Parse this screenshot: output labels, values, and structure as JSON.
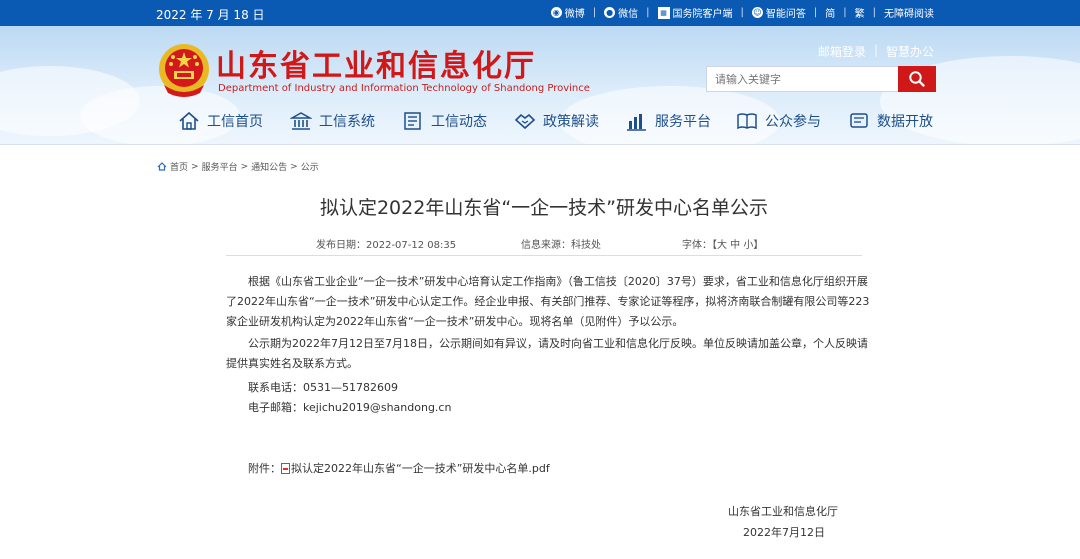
{
  "topbar": {
    "date": "2022 年 7 月 18 日",
    "links": [
      {
        "label": "微博",
        "icon": "weibo-icon"
      },
      {
        "label": "微信",
        "icon": "wechat-icon"
      },
      {
        "label": "国务院客户端",
        "icon": "gov-client-icon"
      },
      {
        "label": "智能问答",
        "icon": "robot-icon"
      },
      {
        "label": "简"
      },
      {
        "label": "繁"
      },
      {
        "label": "无障碍阅读"
      }
    ]
  },
  "header": {
    "title": "山东省工业和信息化厅",
    "subtitle": "Department of Industry and Information Technology of Shandong Province",
    "mail_login": "邮箱登录",
    "smart_office": "智慧办公",
    "search_placeholder": "请输入关键字"
  },
  "nav": [
    {
      "label": "工信首页",
      "icon": "home-icon"
    },
    {
      "label": "工信系统",
      "icon": "building-icon"
    },
    {
      "label": "工信动态",
      "icon": "news-icon"
    },
    {
      "label": "政策解读",
      "icon": "handshake-icon"
    },
    {
      "label": "服务平台",
      "icon": "platform-icon"
    },
    {
      "label": "公众参与",
      "icon": "book-icon"
    },
    {
      "label": "数据开放",
      "icon": "data-icon"
    }
  ],
  "breadcrumb": [
    "首页",
    "服务平台",
    "通知公告",
    "公示"
  ],
  "article": {
    "title": "拟认定2022年山东省“一企一技术”研发中心名单公示",
    "publish_date": "发布日期：2022-07-12 08:35",
    "source": "信息来源：科技处",
    "font_size_label": "字体：【大 中 小】",
    "paragraph1": "根据《山东省工业企业“一企一技术”研发中心培育认定工作指南》（鲁工信技〔2020〕37号）要求，省工业和信息化厅组织开展了2022年山东省“一企一技术”研发中心认定工作。经企业申报、有关部门推荐、专家论证等程序，拟将济南联合制罐有限公司等223家企业研发机构认定为2022年山东省“一企一技术”研发中心。现将名单（见附件）予以公示。",
    "paragraph2": "公示期为2022年7月12日至7月18日，公示期间如有异议，请及时向省工业和信息化厅反映。单位反映请加盖公章，个人反映请提供真实姓名及联系方式。",
    "phone": "联系电话：0531—51782609",
    "email": "电子邮箱：kejichu2019@shandong.cn",
    "attachment_label": "附件：",
    "attachment_name": "拟认定2022年山东省“一企一技术”研发中心名单.pdf",
    "signature_org": "山东省工业和信息化厅",
    "signature_date": "2022年7月12日"
  },
  "colors": {
    "topbar": "#0a5ab4",
    "title_red": "#d01818",
    "nav_text": "#1d4f8c"
  }
}
